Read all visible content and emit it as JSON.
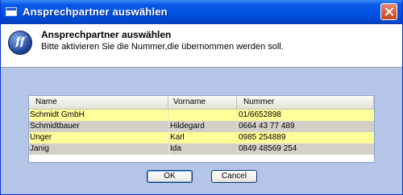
{
  "window": {
    "title": "Ansprechpartner auswählen"
  },
  "header": {
    "title": "Ansprechpartner auswählen",
    "subtitle": "Bitte aktivieren Sie die Nummer,die übernommen werden soll.",
    "logo_text": "ff"
  },
  "table": {
    "columns": [
      "Name",
      "Vorname",
      "Nummer"
    ],
    "rows": [
      {
        "name": "Schmidt GmbH",
        "vorname": "",
        "nummer": "01/6652898"
      },
      {
        "name": "Schmidtbauer",
        "vorname": "Hildegard",
        "nummer": "0664 43 77 489"
      },
      {
        "name": "Unger",
        "vorname": "Karl",
        "nummer": "0985 254889"
      },
      {
        "name": "Janig",
        "vorname": "Ida",
        "nummer": "0849 48569 254"
      }
    ]
  },
  "buttons": {
    "ok": "OK",
    "cancel": "Cancel"
  },
  "colors": {
    "row_highlight": "#ffff99",
    "row_alt": "#d4d0c8",
    "body_bg": "#b4c5e8",
    "titlebar": "#0052e0"
  }
}
